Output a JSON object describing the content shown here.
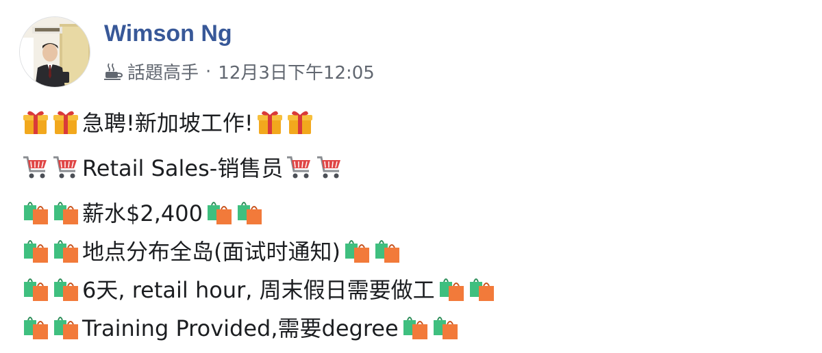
{
  "author": {
    "name": "Wimson Ng"
  },
  "meta": {
    "badge": "話題高手",
    "separator": "·",
    "timestamp": "12月3日下午12:05"
  },
  "icons": {
    "badge": "coffee-cup-icon",
    "gift": "gift-emoji",
    "cart": "shopping-cart-emoji",
    "bags": "shopping-bags-emoji"
  },
  "lines": [
    {
      "text": "急聘!新加坡工作!",
      "emoji": "gift"
    },
    {
      "text": "Retail Sales-销售员",
      "emoji": "cart"
    },
    {
      "text": "薪水$2,400",
      "emoji": "bags"
    },
    {
      "text": "地点分布全岛(面试时通知)",
      "emoji": "bags"
    },
    {
      "text": "6天, retail hour, 周末假日需要做工",
      "emoji": "bags"
    },
    {
      "text": "Training Provided,需要degree",
      "emoji": "bags"
    }
  ],
  "colors": {
    "author": "#385898",
    "meta": "#616770",
    "text": "#1c1e21"
  }
}
